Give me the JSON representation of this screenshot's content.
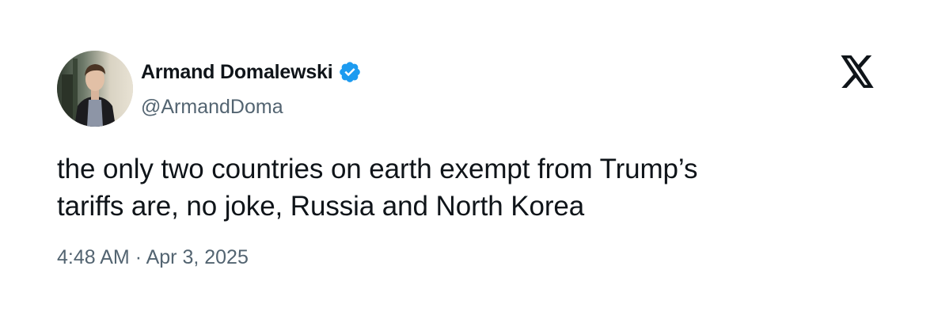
{
  "author": {
    "display_name": "Armand Domalewski",
    "handle": "@ArmandDoma",
    "verified": true,
    "verified_color": "#1d9bf0"
  },
  "tweet": {
    "text_line1": "the only two countries on earth exempt from Trump’s",
    "text_line2": "tariffs are, no joke, Russia and North Korea",
    "time": "4:48 AM",
    "separator": "·",
    "date": "Apr 3, 2025"
  },
  "icons": {
    "platform_logo": "x-logo-icon",
    "badge": "verified-badge-icon"
  },
  "colors": {
    "text_primary": "#0f1419",
    "text_secondary": "#536471",
    "background": "#ffffff"
  }
}
